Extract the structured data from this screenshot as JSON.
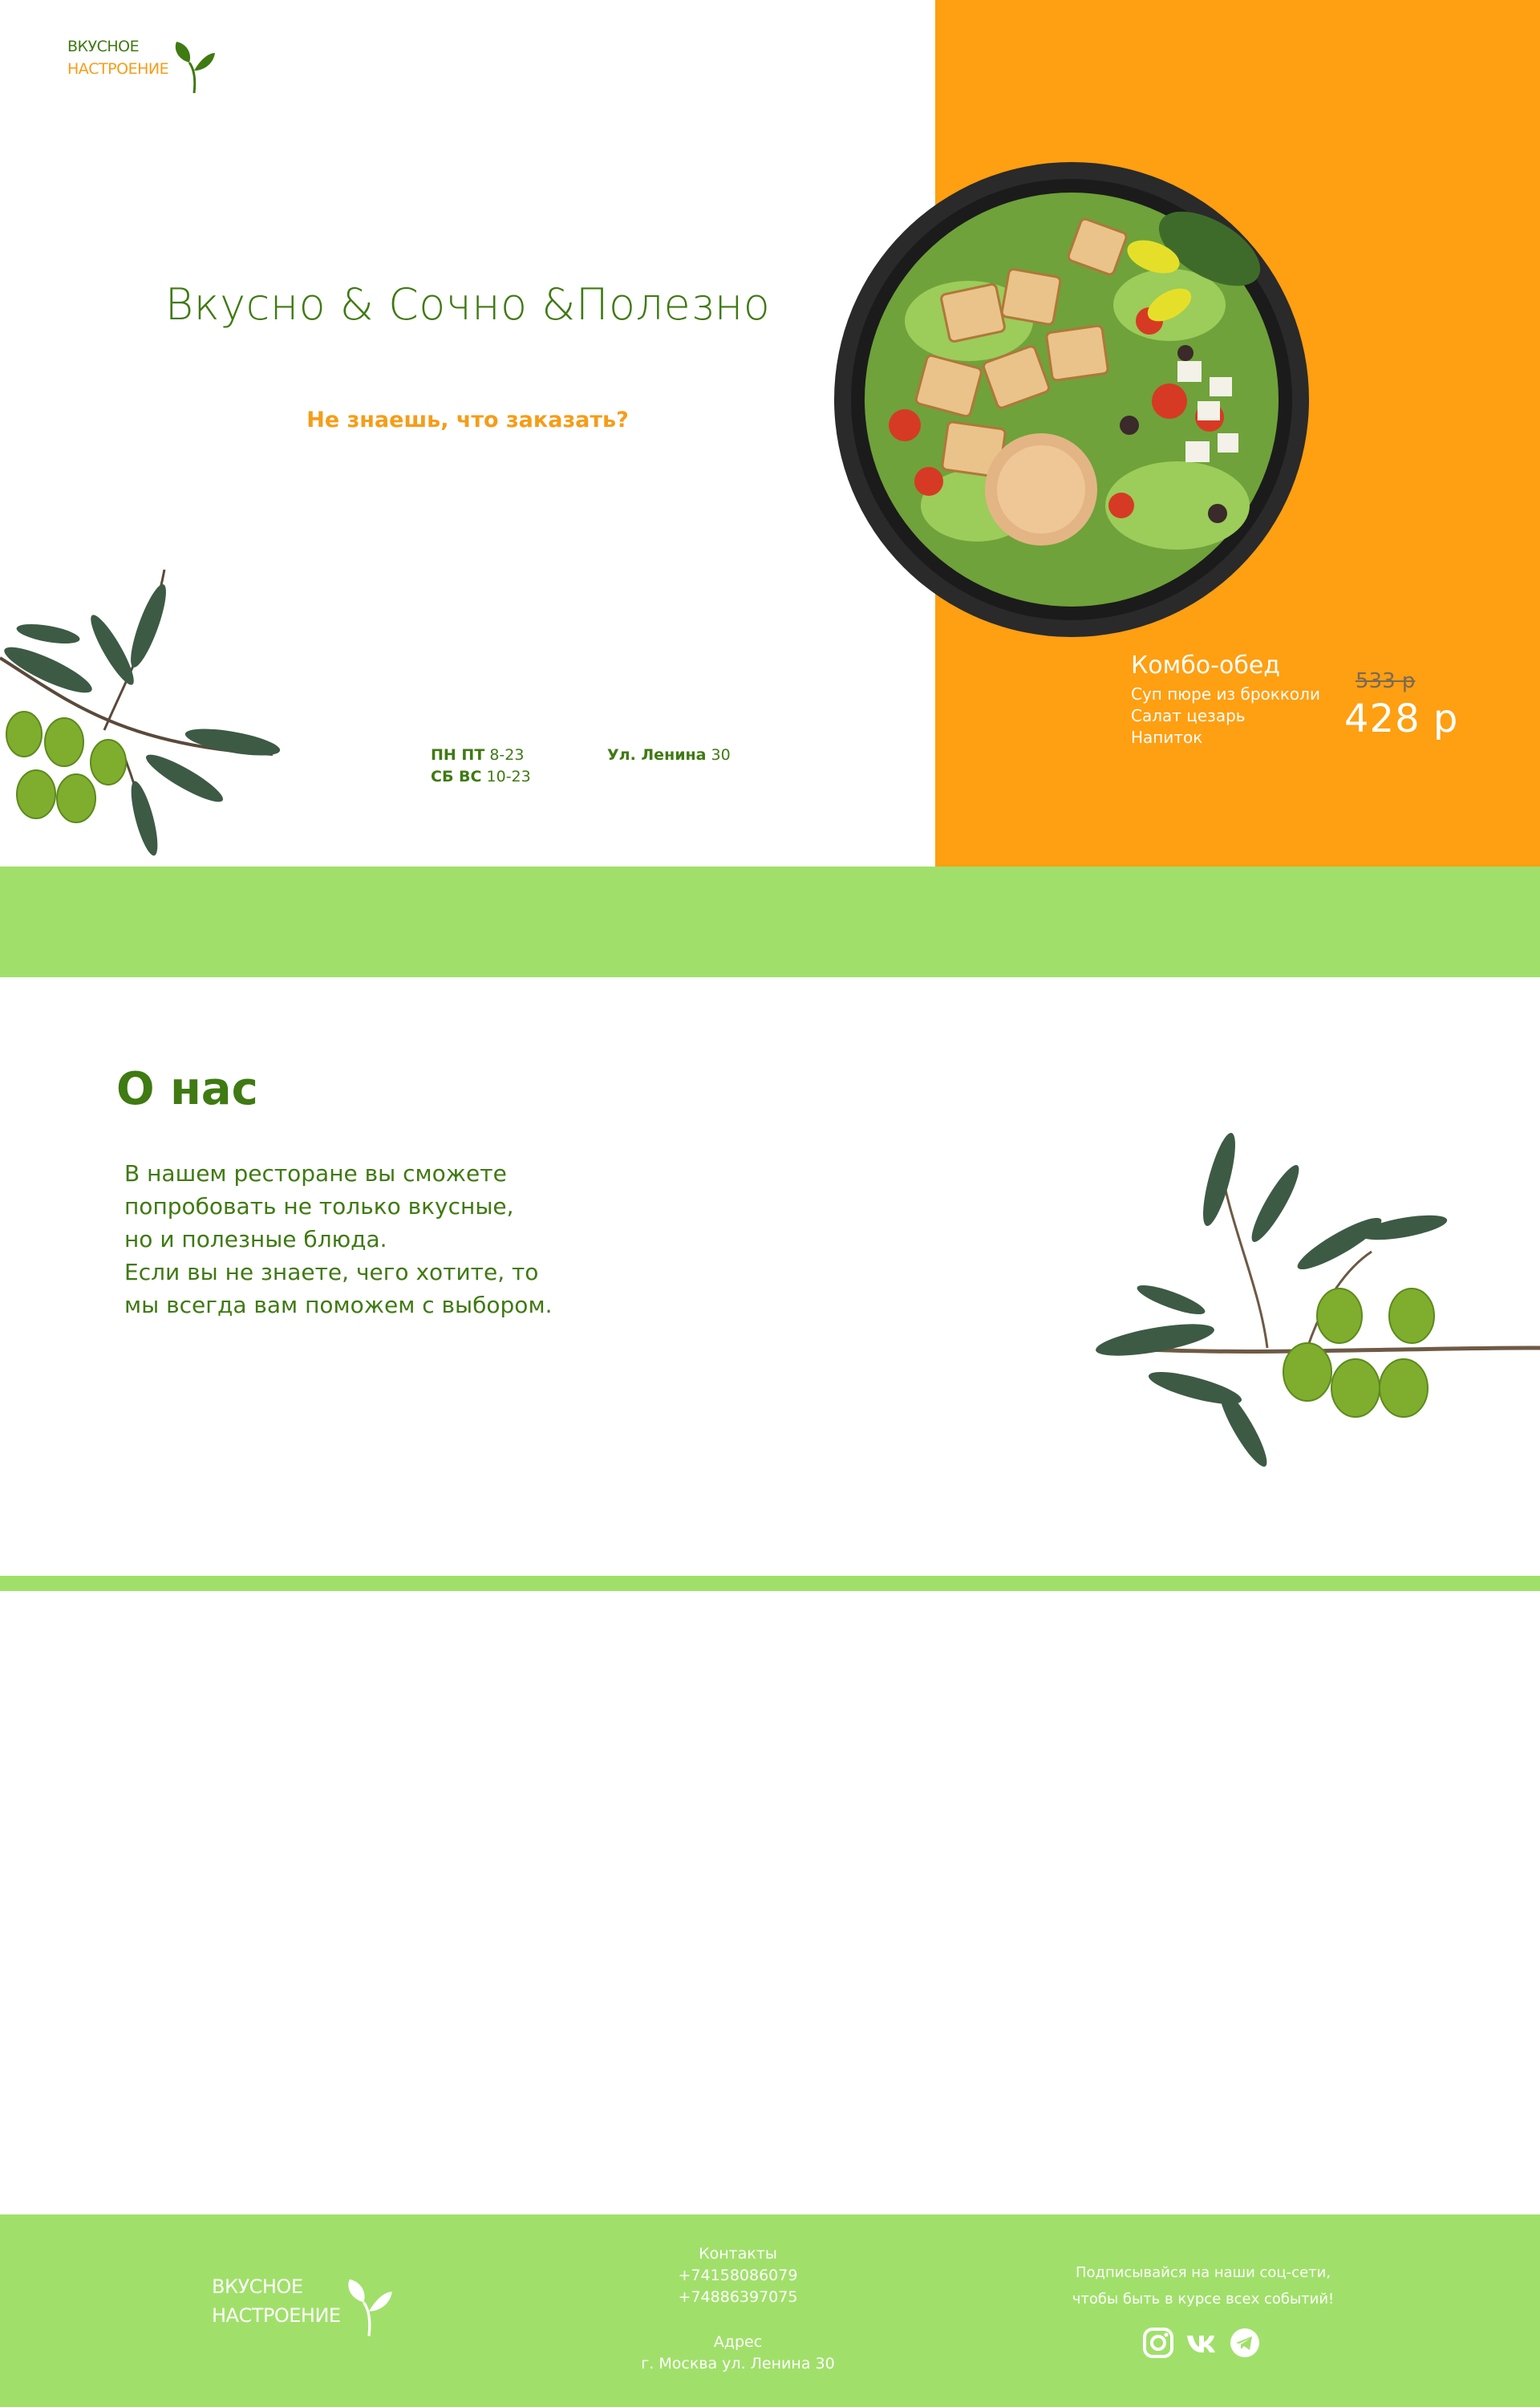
{
  "brand": {
    "line1": "ВКУСНОЕ",
    "line2": "НАСТРОЕНИЕ"
  },
  "hero": {
    "title": "Вкусно & Сочно &Полезно",
    "cta": "Не знаешь, что заказать?",
    "hours": [
      {
        "days": "ПН ПТ",
        "time": "8-23"
      },
      {
        "days": "СБ ВС",
        "time": "10-23"
      }
    ],
    "address": {
      "street": "Ул. Ленина",
      "number": "30"
    }
  },
  "combo": {
    "title": "Комбо-обед",
    "items": [
      "Суп пюре из брокколи",
      "Салат цезарь",
      "Напиток"
    ],
    "old_price": "533 р",
    "new_price": "428 р"
  },
  "about": {
    "title": "О нас",
    "lines": [
      "В нашем ресторане вы сможете",
      "попробовать не только вкусные,",
      "но и полезные блюда.",
      "Если вы не знаете, чего хотите, то",
      "мы всегда вам поможем с выбором."
    ]
  },
  "footer": {
    "contacts_label": "Контакты",
    "phones": [
      "+74158086079",
      "+74886397075"
    ],
    "address_label": "Адрес",
    "address": "г. Москва ул. Ленина 30",
    "social_text_1": "Подписывайся на наши соц-сети,",
    "social_text_2": "чтобы быть в курсе всех событий!",
    "social_icons": [
      "instagram-icon",
      "vk-icon",
      "telegram-icon"
    ]
  },
  "colors": {
    "orange": "#ff9f12",
    "green_band": "#a0e06a",
    "dark_green_text": "#3f7a12",
    "accent_orange_text": "#f59d1a"
  }
}
